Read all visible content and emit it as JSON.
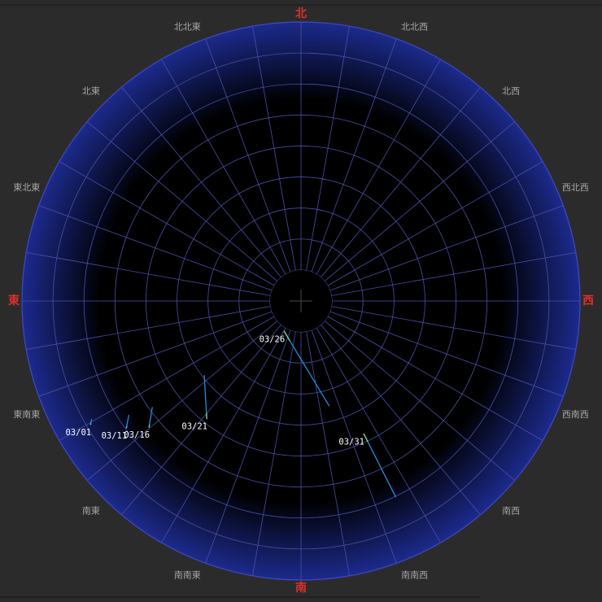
{
  "colors": {
    "background": "#2b2b2b",
    "disk_center": "#000000",
    "disk_edge": "#1c2a8c",
    "grid": "#4a4fa8",
    "rim": "#3f49c8",
    "track": "#1e8fe0",
    "track_tip": "#7fd08a",
    "main_direction": "#e0302a",
    "minor_direction": "#a6a6a6",
    "date_text": "#ffffff"
  },
  "directions": [
    {
      "name": "北",
      "azimuth": 0,
      "main": true
    },
    {
      "name": "北北東",
      "azimuth": 22.5,
      "main": false
    },
    {
      "name": "北東",
      "azimuth": 45,
      "main": false
    },
    {
      "name": "東北東",
      "azimuth": 67.5,
      "main": false
    },
    {
      "name": "東",
      "azimuth": 90,
      "main": true
    },
    {
      "name": "東南東",
      "azimuth": 112.5,
      "main": false
    },
    {
      "name": "南東",
      "azimuth": 135,
      "main": false
    },
    {
      "name": "南南東",
      "azimuth": 157.5,
      "main": false
    },
    {
      "name": "南",
      "azimuth": 180,
      "main": true
    },
    {
      "name": "南南西",
      "azimuth": 202.5,
      "main": false
    },
    {
      "name": "南西",
      "azimuth": 225,
      "main": false
    },
    {
      "name": "西南西",
      "azimuth": 247.5,
      "main": false
    },
    {
      "name": "西",
      "azimuth": 270,
      "main": true
    },
    {
      "name": "西北西",
      "azimuth": 292.5,
      "main": false
    },
    {
      "name": "北西",
      "azimuth": 315,
      "main": false
    },
    {
      "name": "北北西",
      "azimuth": 337.5,
      "main": false
    }
  ],
  "chart_data": {
    "type": "scatter",
    "projection": "polar-sky-map",
    "azimuth_direction": "north-top-east-left",
    "altitude_range": [
      0,
      90
    ],
    "altitude_rings_deg": [
      10,
      20,
      30,
      40,
      50,
      60,
      70,
      80
    ],
    "azimuth_spokes_deg": 10,
    "grid": true,
    "title": "",
    "tracks": [
      {
        "label": "03/01",
        "start": {
          "az": 120.4,
          "alt": 11.3
        },
        "end": {
          "az": 119.5,
          "alt": 12.4
        }
      },
      {
        "label": "03/11",
        "start": {
          "az": 126.0,
          "alt": 20.4
        },
        "end": {
          "az": 123.6,
          "alt": 23.3
        }
      },
      {
        "label": "03/16",
        "start": {
          "az": 129.7,
          "alt": 26.3
        },
        "end": {
          "az": 125.6,
          "alt": 31.0
        }
      },
      {
        "label": "03/21",
        "start": {
          "az": 141.3,
          "alt": 41.4
        },
        "end": {
          "az": 127.6,
          "alt": 50.6
        }
      },
      {
        "label": "03/26",
        "start": {
          "az": 151.1,
          "alt": 78.8
        },
        "end": {
          "az": 195.0,
          "alt": 55.0
        }
      },
      {
        "label": "03/31",
        "start": {
          "az": 205.3,
          "alt": 42.6
        },
        "end": {
          "az": 205.8,
          "alt": 19.9
        }
      }
    ]
  }
}
